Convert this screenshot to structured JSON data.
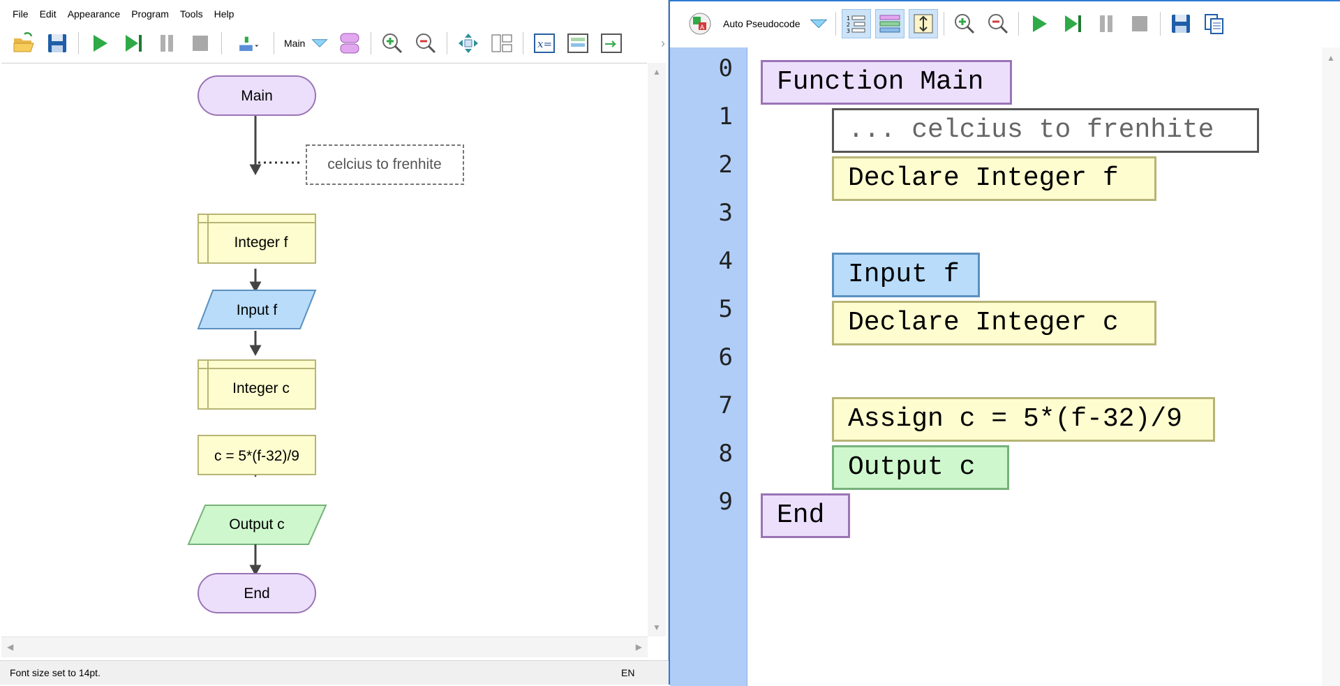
{
  "menu": [
    "File",
    "Edit",
    "Appearance",
    "Program",
    "Tools",
    "Help"
  ],
  "toolbar": {
    "open": "open-folder-icon",
    "save": "save-icon",
    "run": "run-icon",
    "step": "step-icon",
    "pause": "pause-icon",
    "stop": "stop-icon",
    "function_selector_label": "Main"
  },
  "flowchart": {
    "nodes": {
      "start": "Main",
      "comment": "celcius to frenhite",
      "declare_f": "Integer f",
      "input_f": "Input f",
      "declare_c": "Integer c",
      "assign": "c = 5*(f-32)/9",
      "output": "Output c",
      "end": "End"
    }
  },
  "status": {
    "message": "Font size set to 14pt.",
    "language": "EN"
  },
  "pseudocode": {
    "mode_label": "Auto Pseudocode",
    "line_numbers": [
      "0",
      "1",
      "2",
      "3",
      "4",
      "5",
      "6",
      "7",
      "8",
      "9"
    ],
    "lines": {
      "l0": "Function Main",
      "l1": "... celcius to frenhite",
      "l2": "Declare Integer f",
      "l4": "Input f",
      "l5": "Declare Integer c",
      "l7": "Assign c = 5*(f-32)/9",
      "l8": "Output c",
      "l9": "End"
    }
  },
  "colors": {
    "terminal": "#ecdffc",
    "declare": "#fdfdcf",
    "input": "#b8dcfa",
    "output": "#cef7cd",
    "gutter": "#afcdf7",
    "accent": "#2b78d4"
  }
}
